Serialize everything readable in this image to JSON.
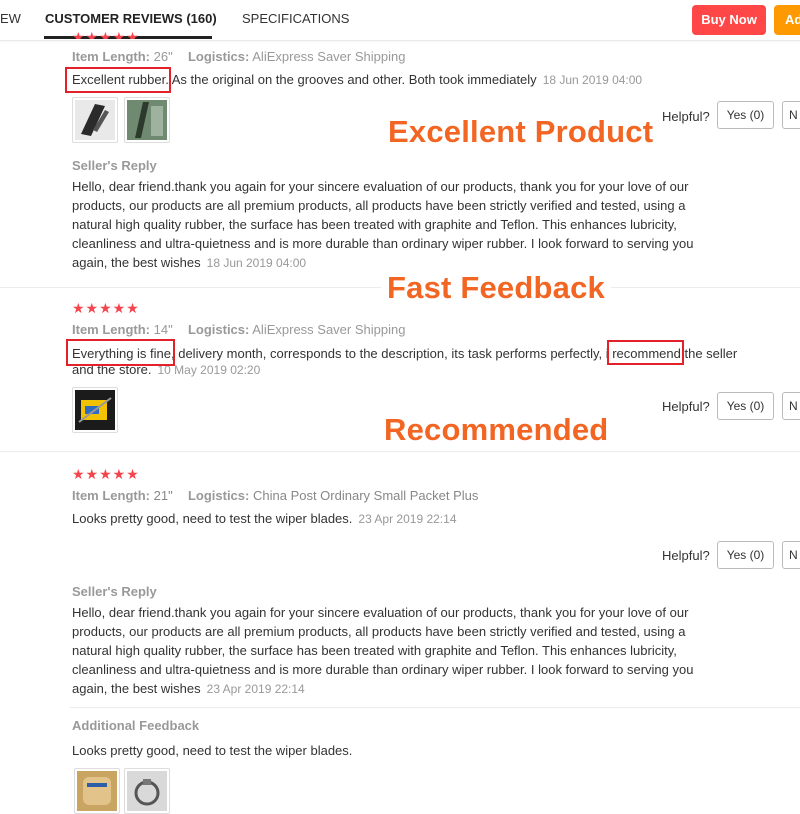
{
  "nav": {
    "tab_overview": "EW",
    "tab_reviews": "CUSTOMER REVIEWS (160)",
    "tab_specs": "SPECIFICATIONS",
    "buy_now": "Buy Now",
    "add_cart": "Ad"
  },
  "overlays": {
    "caption1": "Excellent Product",
    "caption2": "Fast Feedback",
    "caption3": "Recommended"
  },
  "common": {
    "item_length_key": "Item Length:",
    "logistics_key": "Logistics:",
    "sellers_reply": "Seller's Reply",
    "helpful": "Helpful?",
    "yes": "Yes (0)",
    "no": "N",
    "additional_feedback": "Additional Feedback",
    "reply_text": "Hello, dear friend.thank you again for your sincere evaluation of our products, thank you for your love of our products, our products are all premium products, all products have been strictly verified and tested, using a natural high quality rubber, the surface has been treated with graphite and Teflon. This enhances lubricity, cleanliness and ultra-quietness and is more durable than ordinary wiper rubber. I look forward to serving you again, the best wishes"
  },
  "reviews": [
    {
      "stars": "★★★★★",
      "item_length": "26\"",
      "logistics": "AliExpress Saver Shipping",
      "text_hl": "Excellent rubber.",
      "text_rest": " As the original on the grooves and other. Both took immediately",
      "date": "18 Jun 2019 04:00",
      "reply_date": "18 Jun 2019 04:00",
      "thumbs": [
        "wiper-photo-1",
        "wiper-photo-2"
      ]
    },
    {
      "stars": "★★★★★",
      "item_length": "14\"",
      "logistics": "AliExpress Saver Shipping",
      "text_hl1": "Everything is fine,",
      "text_mid": " delivery month, corresponds to the description, its task performs perfectly, i ",
      "text_hl2": "recommend",
      "text_end": " the seller",
      "text_line2": "and the store.",
      "date": "10 May 2019 02:20",
      "thumbs": [
        "wiper-package-photo"
      ]
    },
    {
      "stars": "★★★★★",
      "item_length": "21\"",
      "logistics": "China Post Ordinary Small Packet Plus",
      "text": "Looks pretty good, need to test the wiper blades.",
      "date": "23 Apr 2019 22:14",
      "reply_date": "23 Apr 2019 22:14",
      "additional_text": "Looks pretty good, need to test the wiper blades.",
      "thumbs": [
        "package-photo-1",
        "package-photo-2"
      ]
    }
  ],
  "colors": {
    "buy_now": "#ff4747",
    "add_cart": "#ff9900",
    "stars": "#f5444c",
    "overlay_text": "#f26522",
    "highlight_box": "#e4202a"
  }
}
